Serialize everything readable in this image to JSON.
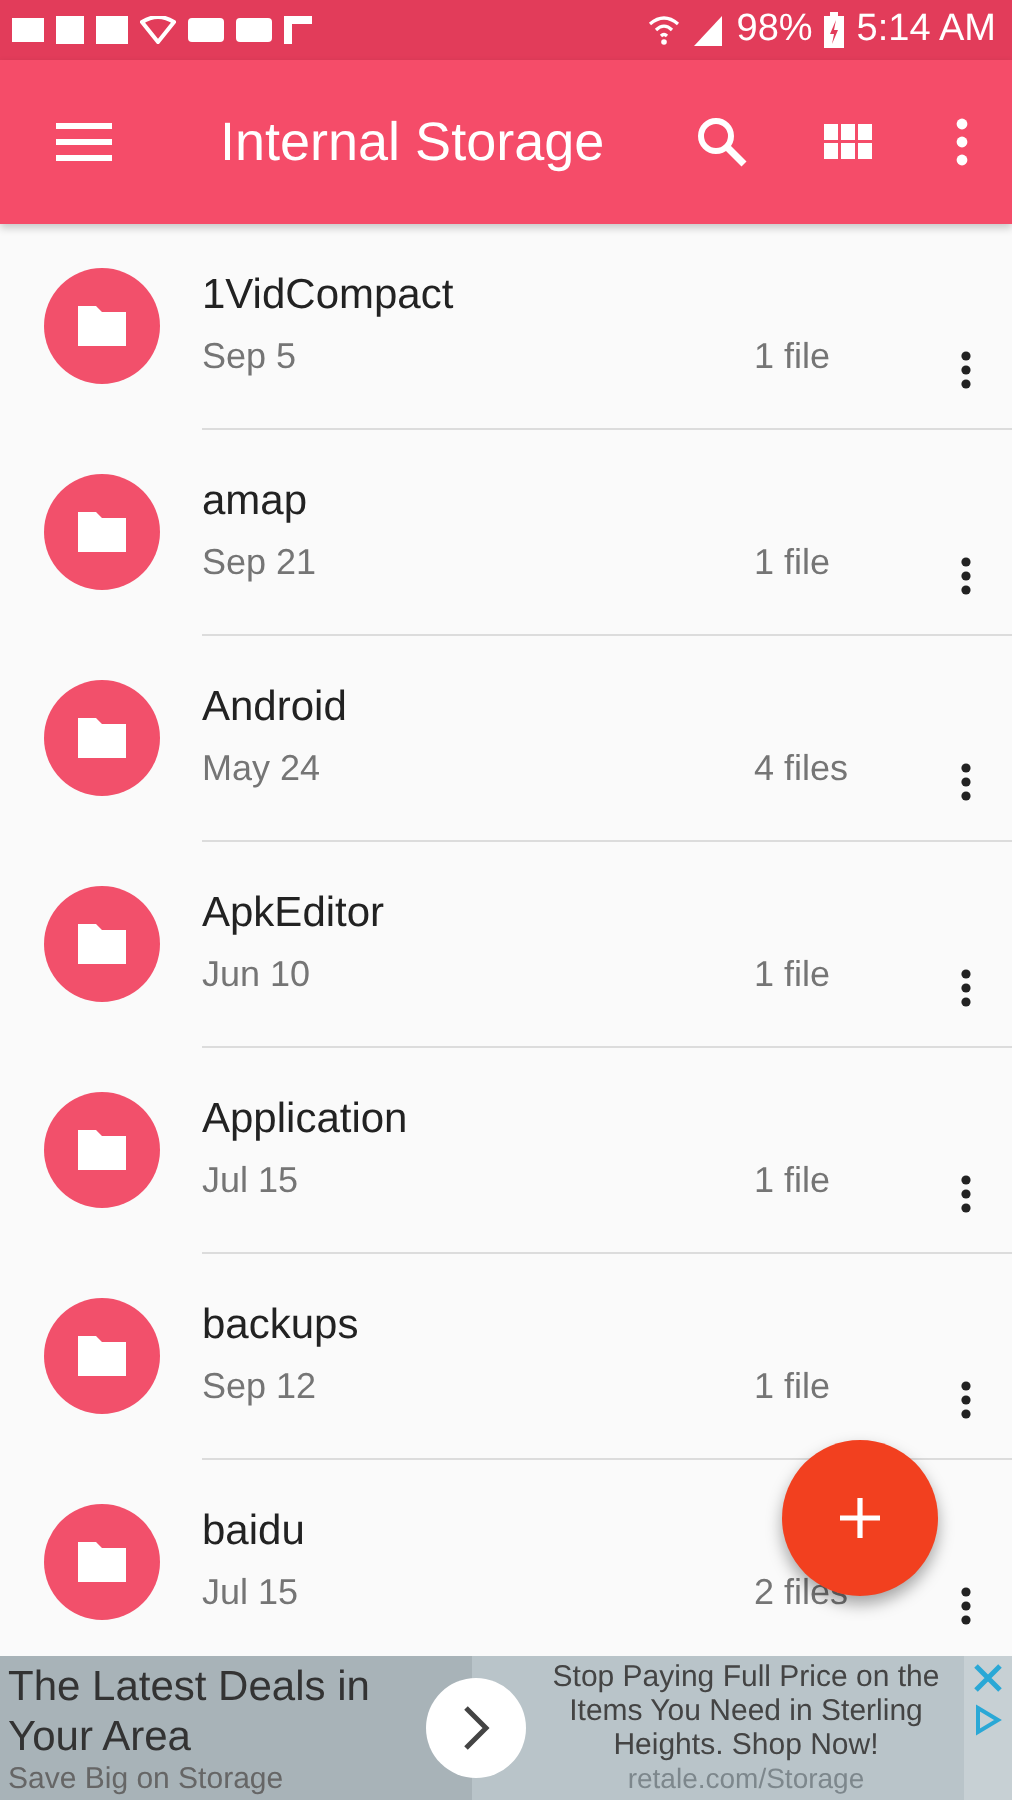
{
  "status_bar": {
    "battery": "98%",
    "time": "5:14 AM"
  },
  "toolbar": {
    "title": "Internal Storage"
  },
  "folders": [
    {
      "name": "1VidCompact",
      "date": "Sep 5",
      "count": "1 file"
    },
    {
      "name": "amap",
      "date": "Sep 21",
      "count": "1 file"
    },
    {
      "name": "Android",
      "date": "May 24",
      "count": "4 files"
    },
    {
      "name": "ApkEditor",
      "date": "Jun 10",
      "count": "1 file"
    },
    {
      "name": "Application",
      "date": "Jul 15",
      "count": "1 file"
    },
    {
      "name": "backups",
      "date": "Sep 12",
      "count": "1 file"
    },
    {
      "name": "baidu",
      "date": "Jul 15",
      "count": "2 files"
    }
  ],
  "ad": {
    "headline": "The Latest Deals in Your Area",
    "subline": "Save Big on Storage",
    "body": "Stop Paying Full Price on the Items You Need in Sterling Heights. Shop Now!",
    "url": "retale.com/Storage"
  }
}
